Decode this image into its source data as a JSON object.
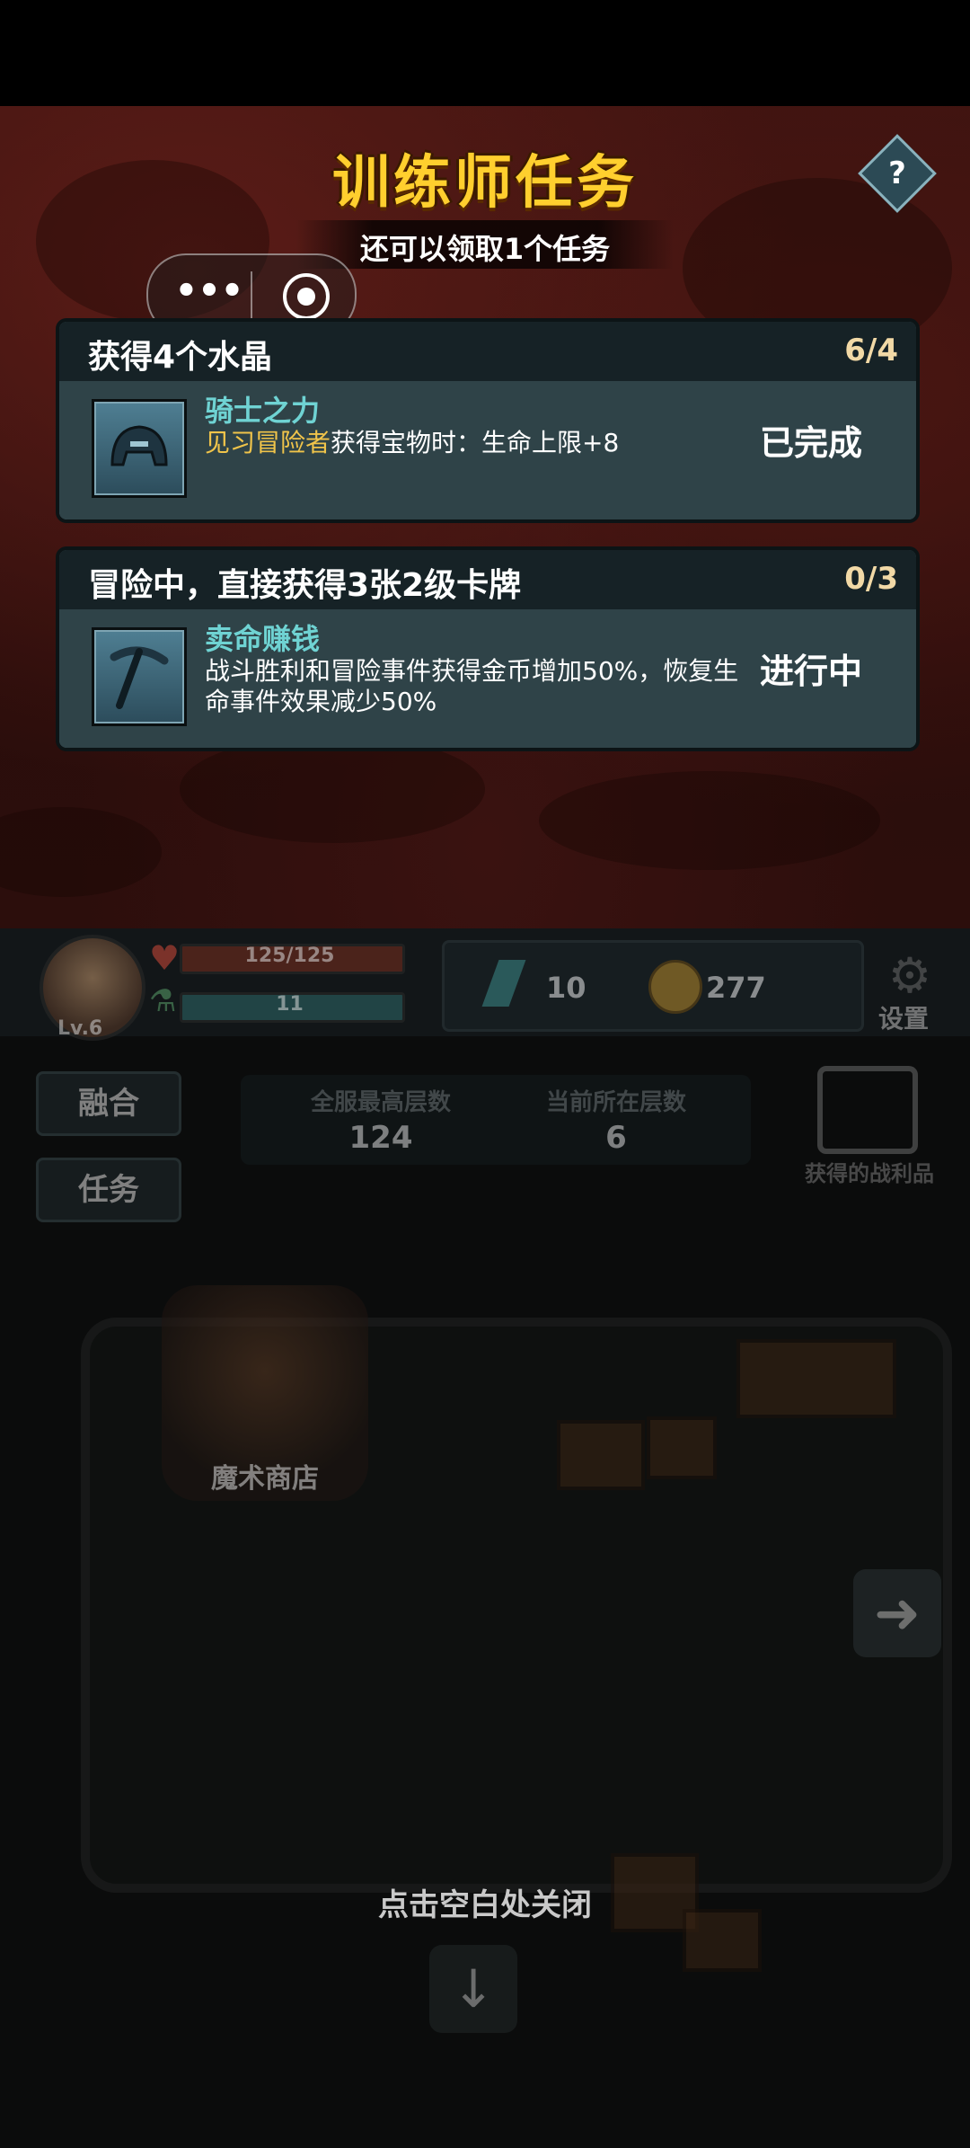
{
  "header": {
    "title": "训练师任务",
    "subtitle": "还可以领取1个任务",
    "help_glyph": "?"
  },
  "capsule": {
    "more_glyph": "•••"
  },
  "tasks": [
    {
      "title": "获得4个水晶",
      "progress": "6/4",
      "reward_name": "骑士之力",
      "desc_highlight": "见习冒险者",
      "desc": "获得宝物时：生命上限+8",
      "status": "已完成",
      "icon": "knight-helmet-icon"
    },
    {
      "title": "冒险中，直接获得3张2级卡牌",
      "progress": "0/3",
      "reward_name": "卖命赚钱",
      "desc_highlight": "",
      "desc": "战斗胜利和冒险事件获得金币增加50%，恢复生命事件效果减少50%",
      "status": "进行中",
      "icon": "pickaxe-icon"
    }
  ],
  "hud": {
    "level": "Lv.6",
    "hp": "125/125",
    "energy": "11",
    "crystals": "10",
    "coins": "277",
    "settings_label": "设置"
  },
  "side": {
    "fuse_label": "融合",
    "task_label": "任务"
  },
  "floors": {
    "best_label": "全服最高层数",
    "best_value": "124",
    "current_label": "当前所在层数",
    "current_value": "6"
  },
  "loot_label": "获得的战利品",
  "shop_label": "魔术商店",
  "close_hint": "点击空白处关闭",
  "colors": {
    "title": "#ffcf2e",
    "reward_name": "#6fd3d3",
    "highlight": "#f0c44a"
  }
}
